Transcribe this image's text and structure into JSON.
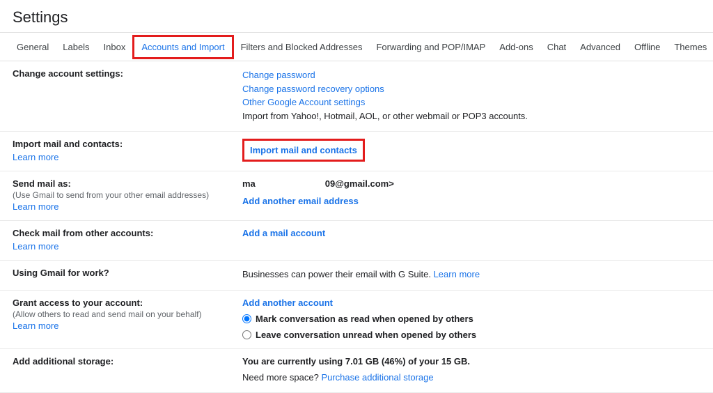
{
  "pageTitle": "Settings",
  "tabs": {
    "general": "General",
    "labels": "Labels",
    "inbox": "Inbox",
    "accountsImport": "Accounts and Import",
    "filters": "Filters and Blocked Addresses",
    "forwarding": "Forwarding and POP/IMAP",
    "addons": "Add-ons",
    "chat": "Chat",
    "advanced": "Advanced",
    "offline": "Offline",
    "themes": "Themes"
  },
  "changeAccount": {
    "heading": "Change account settings:",
    "links": {
      "changePassword": "Change password",
      "recoveryOptions": "Change password recovery options",
      "otherSettings": "Other Google Account settings"
    },
    "importNote": "Import from Yahoo!, Hotmail, AOL, or other webmail or POP3 accounts."
  },
  "importMail": {
    "heading": "Import mail and contacts:",
    "learnMore": "Learn more",
    "action": "Import mail and contacts"
  },
  "sendMailAs": {
    "heading": "Send mail as:",
    "sub": "(Use Gmail to send from your other email addresses)",
    "learnMore": "Learn more",
    "emailPrefix": "ma",
    "emailSuffix": "09@gmail.com>",
    "action": "Add another email address"
  },
  "checkMail": {
    "heading": "Check mail from other accounts:",
    "learnMore": "Learn more",
    "action": "Add a mail account"
  },
  "gmailWork": {
    "heading": "Using Gmail for work?",
    "text": "Businesses can power their email with G Suite. ",
    "learnMore": "Learn more"
  },
  "grantAccess": {
    "heading": "Grant access to your account:",
    "sub": "(Allow others to read and send mail on your behalf)",
    "learnMore": "Learn more",
    "action": "Add another account",
    "radio1": "Mark conversation as read when opened by others",
    "radio2": "Leave conversation unread when opened by others"
  },
  "storage": {
    "heading": "Add additional storage:",
    "usageText": "You are currently using 7.01 GB (46%) of your 15 GB.",
    "moreSpace": "Need more space? ",
    "purchaseLink": "Purchase additional storage"
  }
}
